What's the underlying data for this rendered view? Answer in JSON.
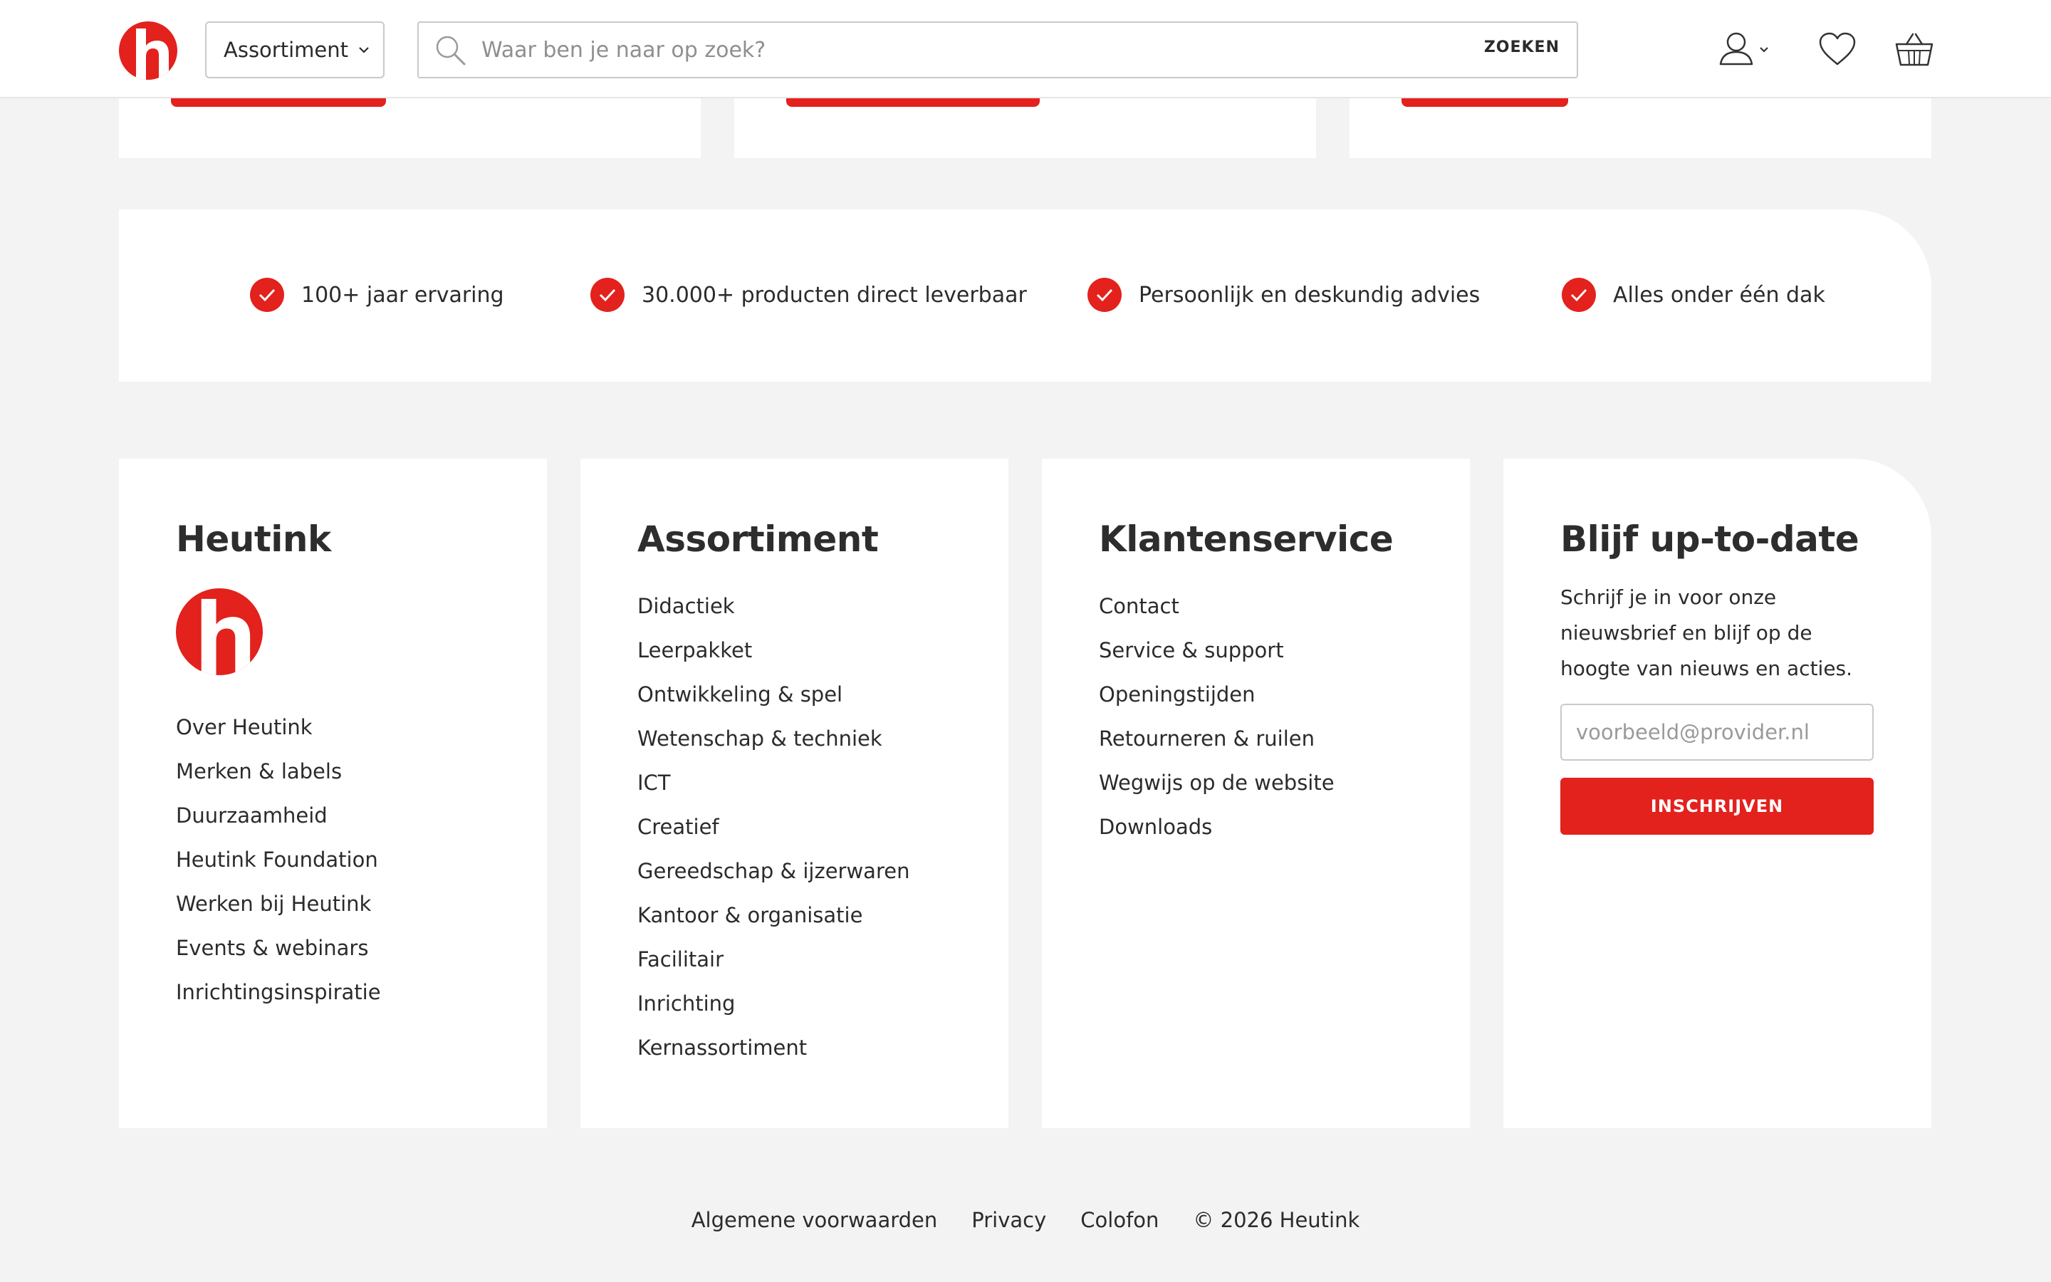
{
  "header": {
    "assortment_label": "Assortiment",
    "search_placeholder": "Waar ben je naar op zoek?",
    "search_button": "ZOEKEN"
  },
  "usps": [
    {
      "label": "100+ jaar ervaring"
    },
    {
      "label": "30.000+ producten direct leverbaar"
    },
    {
      "label": "Persoonlijk en deskundig advies"
    },
    {
      "label": "Alles onder één dak"
    }
  ],
  "footer": {
    "heutink": {
      "title": "Heutink",
      "links": [
        "Over Heutink",
        "Merken & labels",
        "Duurzaamheid",
        "Heutink Foundation",
        "Werken bij Heutink",
        "Events & webinars",
        "Inrichtingsinspiratie"
      ]
    },
    "assortiment": {
      "title": "Assortiment",
      "links": [
        "Didactiek",
        "Leerpakket",
        "Ontwikkeling & spel",
        "Wetenschap & techniek",
        "ICT",
        "Creatief",
        "Gereedschap & ijzerwaren",
        "Kantoor & organisatie",
        "Facilitair",
        "Inrichting",
        "Kernassortiment"
      ]
    },
    "klantenservice": {
      "title": "Klantenservice",
      "links": [
        "Contact",
        "Service & support",
        "Openingstijden",
        "Retourneren & ruilen",
        "Wegwijs op de website",
        "Downloads"
      ]
    },
    "newsletter": {
      "title": "Blijf up-to-date",
      "text": "Schrijf je in voor onze nieuwsbrief en blijf op de hoogte van nieuws en acties.",
      "input_placeholder": "voorbeeld@provider.nl",
      "button": "INSCHRIJVEN"
    }
  },
  "bottom_links": [
    "Algemene voorwaarden",
    "Privacy",
    "Colofon"
  ],
  "copyright": "© 2026 Heutink",
  "colors": {
    "brand_red": "#e3211d",
    "page_bg": "#f3f3f3",
    "text": "#2b2b2b"
  },
  "icons": [
    "heutink-logo",
    "chevron-down-icon",
    "search-icon",
    "user-icon",
    "heart-icon",
    "basket-icon",
    "check-icon"
  ]
}
